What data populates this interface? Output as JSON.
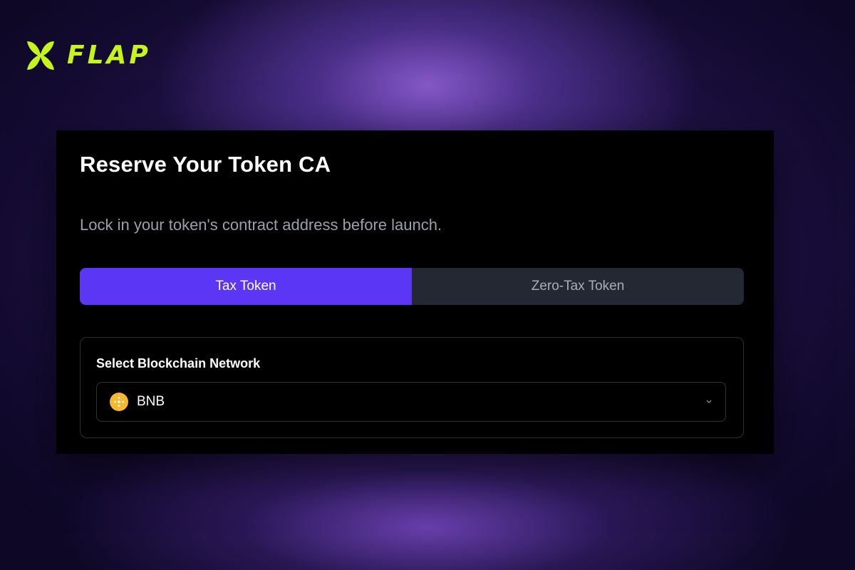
{
  "brand": {
    "name": "FLAP",
    "accent_color": "#c6f51c",
    "logo_icon": "butterfly-x-icon"
  },
  "card": {
    "title": "Reserve Your Token CA",
    "subtitle": "Lock in your token's contract address before launch."
  },
  "tabs": [
    {
      "label": "Tax Token",
      "selected": true
    },
    {
      "label": "Zero-Tax Token",
      "selected": false
    }
  ],
  "network": {
    "label": "Select Blockchain Network",
    "selected": "BNB",
    "selected_icon": "bnb-icon",
    "dropdown_icon": "chevron-down-icon"
  },
  "colors": {
    "active_tab": "#5b36f5",
    "inactive_tab": "#232833",
    "bnb": "#f3ba2f"
  }
}
